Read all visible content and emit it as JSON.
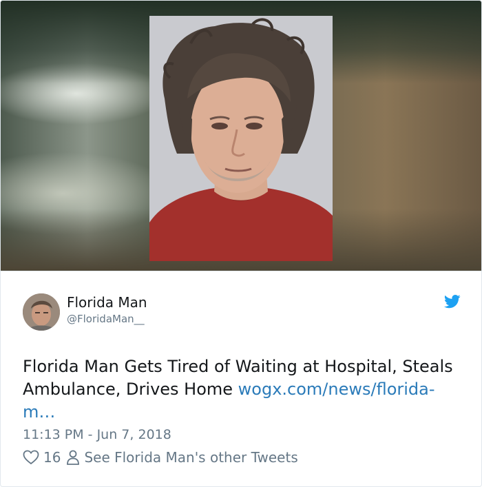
{
  "media": {
    "alt_icon": "mugshot-photo"
  },
  "tweet": {
    "author_name": "Florida Man",
    "author_handle": "@FloridaMan__",
    "text_main": "Florida Man Gets Tired of Waiting at Hospital, Steals Ambulance, Drives Home ",
    "link_text": "wogx.com/news/florida-m…",
    "timestamp": "11:13 PM - Jun 7, 2018",
    "likes": "16",
    "see_other": "See Florida Man's other Tweets"
  },
  "colors": {
    "link": "#2b7bb9",
    "twitter_blue": "#1da1f2",
    "muted": "#657786",
    "text": "#14171a"
  },
  "icons": [
    "twitter-bird-icon",
    "heart-icon",
    "person-icon"
  ]
}
